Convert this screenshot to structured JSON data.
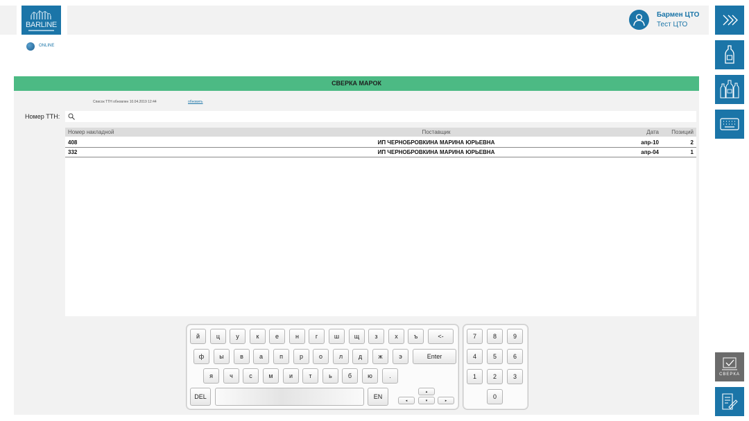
{
  "header": {
    "logo_text": "BARLINE",
    "user": {
      "name": "Бармен ЦТО",
      "role": "Тест ЦТО"
    }
  },
  "status": {
    "label": "ONLINE"
  },
  "section": {
    "title": "СВЕРКА МАРОК",
    "updated_text": "Список ТТН обновлен 10.04.2019 12:44",
    "refresh_label": "обновить"
  },
  "search": {
    "label": "Номер ТТН:",
    "placeholder": ""
  },
  "table": {
    "headers": [
      "Номер накладной",
      "Поставщик",
      "Дата",
      "Позиций"
    ],
    "rows": [
      [
        "408",
        "ИП ЧЕРНОБРОВКИНА МАРИНА ЮРЬЕВНА",
        "апр-10",
        "2"
      ],
      [
        "332",
        "ИП ЧЕРНОБРОВКИНА МАРИНА ЮРЬЕВНА",
        "апр-04",
        "1"
      ]
    ]
  },
  "keyboard": {
    "row1": [
      "й",
      "ц",
      "у",
      "к",
      "е",
      "н",
      "г",
      "ш",
      "щ",
      "з",
      "х",
      "ъ",
      "<-"
    ],
    "row2": [
      "ф",
      "ы",
      "в",
      "а",
      "п",
      "р",
      "о",
      "л",
      "д",
      "ж",
      "э",
      "Enter"
    ],
    "row3": [
      "я",
      "ч",
      "с",
      "м",
      "и",
      "т",
      "ь",
      "б",
      "ю",
      "."
    ],
    "del": "DEL",
    "lang": "EN",
    "arrows": {
      "up": "▴",
      "down": "▾",
      "left": "◂",
      "right": "▸"
    },
    "numpad": [
      "7",
      "8",
      "9",
      "4",
      "5",
      "6",
      "1",
      "2",
      "3",
      "0"
    ]
  },
  "sidebar": {
    "sverka_label": "СВЕРКА",
    "icons": [
      "double-chevron-right-icon",
      "bottle-icon",
      "bottles-icon",
      "keyboard-icon",
      "checkmark-screen-icon",
      "document-pen-icon"
    ]
  },
  "colors": {
    "brand": "#1b75a8",
    "header_green": "#4cba84",
    "panel_gray": "#f2f2f2",
    "sidebar_gray": "#6b6b6b"
  }
}
